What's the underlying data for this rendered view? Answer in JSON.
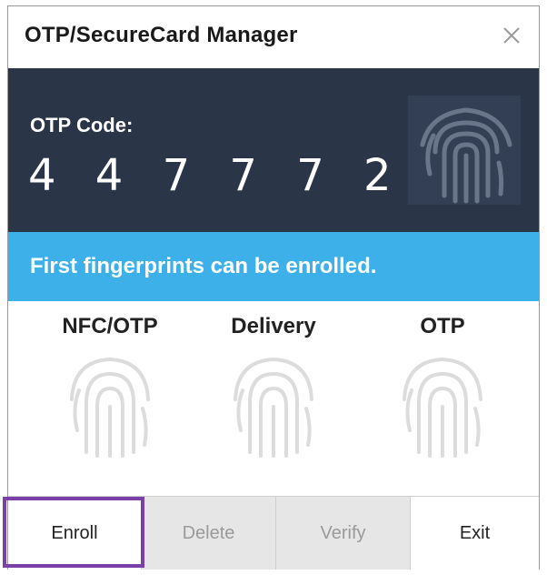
{
  "window": {
    "title": "OTP/SecureCard Manager",
    "close_icon": "close-icon"
  },
  "otp": {
    "label": "OTP Code:",
    "code": "4 4 7 7 7 2",
    "icon": "fingerprint-icon"
  },
  "banner": {
    "text": "First fingerprints can be enrolled."
  },
  "fingers": [
    {
      "label": "NFC/OTP",
      "icon": "fingerprint-icon"
    },
    {
      "label": "Delivery",
      "icon": "fingerprint-icon"
    },
    {
      "label": "OTP",
      "icon": "fingerprint-icon"
    }
  ],
  "buttons": {
    "enroll": "Enroll",
    "delete": "Delete",
    "verify": "Verify",
    "exit": "Exit"
  },
  "colors": {
    "panel": "#2a3548",
    "banner": "#3db0ea",
    "highlight": "#7b3fa8",
    "disabled_bg": "#e6e6e6"
  }
}
